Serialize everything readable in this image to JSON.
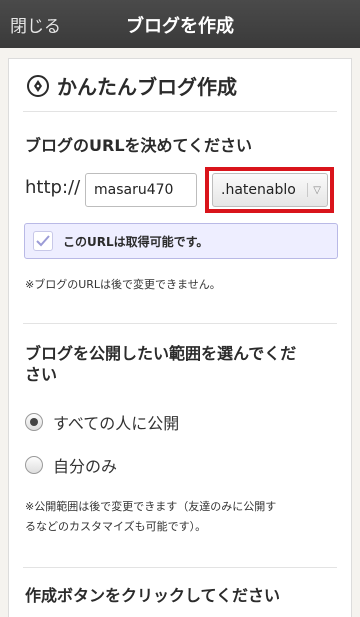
{
  "topbar": {
    "close_label": "閉じる",
    "title": "ブログを作成"
  },
  "heading": {
    "text": "かんたんブログ作成",
    "icon": "pen-nib-icon"
  },
  "url_section": {
    "title": "ブログのURLを決めてください",
    "prefix": "http://",
    "subdomain_value": "masaru470",
    "domain_selected": ".hatenablo",
    "availability_message": "このURLは取得可能です。",
    "note": "※ブログのURLは後で変更できません。"
  },
  "visibility_section": {
    "title_line1": "ブログを公開したい範囲を選んでくだ",
    "title_line2": "さい",
    "options": [
      {
        "label": "すべての人に公開",
        "selected": true
      },
      {
        "label": "自分のみ",
        "selected": false
      }
    ],
    "note_line1": "※公開範囲は後で変更できます（友達のみに公開す",
    "note_line2": "るなどのカスタマイズも可能です）。"
  },
  "create_section": {
    "title": "作成ボタンをクリックしてください"
  },
  "colors": {
    "highlight": "#d9141b",
    "topbar": "#404040",
    "notice_bg": "#eeeeff"
  }
}
